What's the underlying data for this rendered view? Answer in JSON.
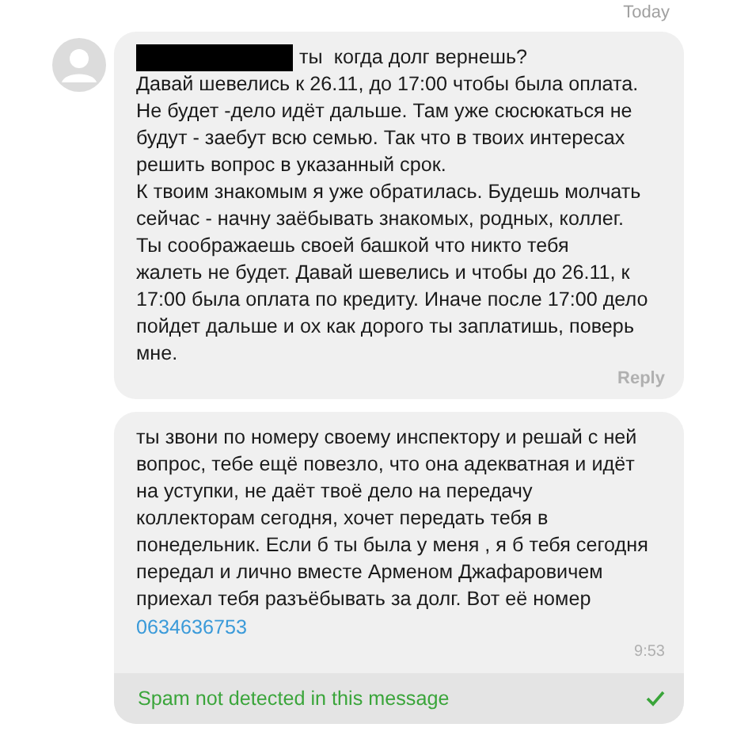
{
  "date_label": "Today",
  "messages": [
    {
      "redacted_sender": true,
      "lines": [
        "ты  когда долг вернешь?",
        "Давай шевелись к 26.11, до 17:00 чтобы была оплата.",
        "Не будет -дело идёт дальше. Там уже сюсюкаться не",
        "будут - заебут всю семью. Так что в твоих интересах",
        "решить вопрос в указанный срок.",
        "К твоим знакомым я уже обратилась. Будешь молчать",
        "сейчас - начну заёбывать знакомых, родных, коллег.",
        "Ты соображаешь своей башкой что никто тебя",
        "жалеть не будет. Давай шевелись и чтобы до 26.11, к",
        "17:00 была оплата по кредиту. Иначе после 17:00 дело",
        "пойдет дальше и ох как дорого ты заплатишь, поверь",
        "мне."
      ],
      "reply": "Reply"
    },
    {
      "redacted_sender": false,
      "lines": [
        "ты звони по номеру своему инспектору и решай с ней",
        "вопрос, тебе ещё повезло, что она адекватная и идёт",
        "на уступки, не даёт твоё дело на передачу",
        "коллекторам сегодня, хочет передать тебя в",
        "понедельник. Если б ты была у меня , я б тебя сегодня",
        "передал и лично вместе Арменом Джафаровичем",
        "приехал тебя разъёбывать за долг. Вот её номер"
      ],
      "link": "0634636753",
      "time": "9:53",
      "spam_notice": "Spam not detected in this message"
    }
  ]
}
